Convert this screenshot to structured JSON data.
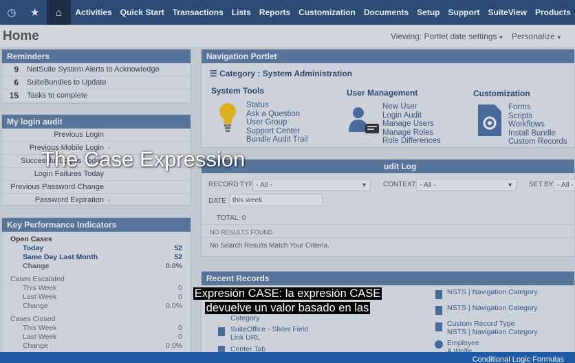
{
  "nav": {
    "icons": [
      "recent-icon",
      "star-icon",
      "home-icon"
    ],
    "menu": [
      "Activities",
      "Quick Start",
      "Transactions",
      "Lists",
      "Reports",
      "Customization",
      "Documents",
      "Setup",
      "Support",
      "SuiteView",
      "Products"
    ]
  },
  "header": {
    "title": "Home",
    "viewing": "Viewing: Portlet date settings",
    "personalize": "Personalize"
  },
  "reminders": {
    "title": "Reminders",
    "items": [
      {
        "count": "9",
        "label": "NetSuite System Alerts to Acknowledge"
      },
      {
        "count": "6",
        "label": "SuiteBundles to Update"
      },
      {
        "count": "15",
        "label": "Tasks to complete"
      }
    ]
  },
  "login_audit": {
    "title": "My login audit",
    "rows": [
      {
        "label": "Previous Login",
        "value": ""
      },
      {
        "label": "Previous Mobile Login",
        "value": "-"
      },
      {
        "label": "Successful Logins Today",
        "value": ""
      },
      {
        "label": "Login Failures Today",
        "value": ""
      },
      {
        "label": "Previous Password Change",
        "value": ""
      },
      {
        "label": "Password Expiration",
        "value": "-"
      }
    ]
  },
  "kpi": {
    "title": "Key Performance Indicators",
    "groups": [
      {
        "name": "Open Cases",
        "rows": [
          {
            "label": "Today",
            "value": "52"
          },
          {
            "label": "Same Day Last Month",
            "value": "52"
          },
          {
            "label": "Change",
            "value": "0.0%"
          }
        ]
      },
      {
        "name": "Cases Escalated",
        "rows": [
          {
            "label": "This Week",
            "value": "0"
          },
          {
            "label": "Last Week",
            "value": "0"
          },
          {
            "label": "Change",
            "value": "0.0%"
          }
        ]
      },
      {
        "name": "Cases Closed",
        "rows": [
          {
            "label": "This Week",
            "value": "0"
          },
          {
            "label": "Last Week",
            "value": "0"
          },
          {
            "label": "Change",
            "value": "0.0%"
          }
        ]
      }
    ]
  },
  "nav_portlet": {
    "title": "Navigation Portlet",
    "category": "Category : System Administration",
    "columns": [
      {
        "title": "System Tools",
        "links": [
          "Status",
          "Ask a Question",
          "User Group",
          "Support Center",
          "Bundle Audit Trail"
        ]
      },
      {
        "title": "User Management",
        "links": [
          "New User",
          "Login Audit",
          "Manage Users",
          "Manage Roles",
          "Role Differences"
        ]
      },
      {
        "title": "Customization",
        "links": [
          "Forms",
          "Scripts",
          "Workflows",
          "Install Bundle",
          "Custom Records"
        ]
      }
    ]
  },
  "audit_log": {
    "title": "udit Log",
    "record_type_label": "RECORD TYPE",
    "record_type_value": "- All -",
    "context_label": "CONTEXT",
    "context_value": "- All -",
    "set_by_label": "SET BY",
    "set_by_value": "- All -",
    "date_label": "DATE",
    "date_value": "this week",
    "total": "TOTAL: 0",
    "no_results": "NO RESULTS FOUND",
    "no_match": "No Search Results Match Your Criteria."
  },
  "recent": {
    "title": "Recent Records",
    "left": [
      {
        "line1": "Category",
        "line2": ""
      },
      {
        "line1": "SuiteOffice - Slider Field",
        "line2": "Link URL"
      },
      {
        "line1": "Center Tab",
        "line2": ""
      }
    ],
    "right": [
      {
        "line1": "NSTS | Navigation Category",
        "line2": ""
      },
      {
        "line1": "NSTS | Navigation Category",
        "line2": ""
      },
      {
        "line1": "Custom Record Type",
        "line2": "NSTS | Navigation Category"
      },
      {
        "line1": "Employee",
        "line2": "A Wolfe"
      }
    ]
  },
  "overlay": {
    "title": "The Case Expression",
    "subtitle_line1": "Expresión CASE: la expresión CASE",
    "subtitle_line2": "devuelve un valor basado en las"
  },
  "footer": {
    "right_text": "Conditional Logic Formulas"
  }
}
